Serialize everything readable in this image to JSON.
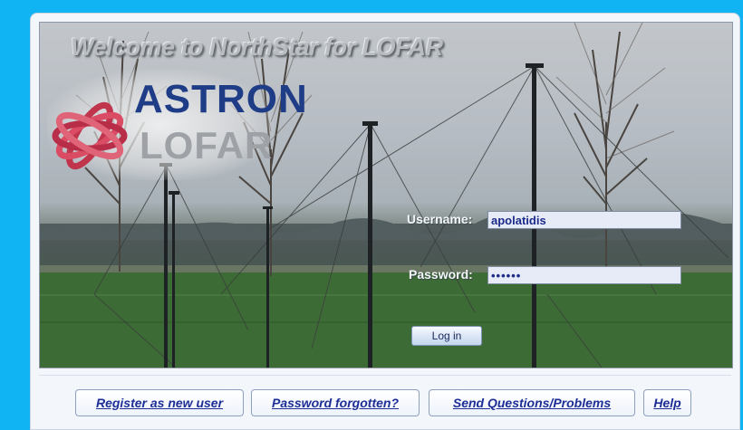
{
  "banner": {
    "welcome": "Welcome to NorthStar for LOFAR",
    "brand_astron": "ASTRON",
    "brand_lofar": "LOFAR"
  },
  "login": {
    "username_label": "Username:",
    "username_value": "apolatidis",
    "password_label": "Password:",
    "password_value": "••••••",
    "login_button": "Log in"
  },
  "footer_links": [
    "Register as new user",
    "Password forgotten?",
    "Send Questions/Problems",
    "Help"
  ],
  "colors": {
    "page_background": "#10b4f2",
    "link_text": "#1d2e96",
    "astron_blue": "#1f3d86"
  }
}
